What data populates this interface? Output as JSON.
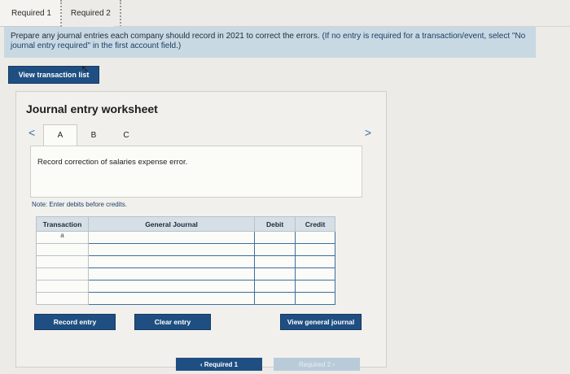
{
  "tabs": [
    {
      "label": "Required 1"
    },
    {
      "label": "Required 2"
    }
  ],
  "instructions": {
    "main": "Prepare any journal entries each company should record in 2021 to correct the errors.",
    "note": "(If no entry is required for a transaction/event, select \"No journal entry required\" in the first account field.)"
  },
  "view_transaction_list_label": "View transaction list",
  "worksheet": {
    "title": "Journal entry worksheet",
    "prev_glyph": "<",
    "next_glyph": ">",
    "sub_tabs": [
      {
        "label": "A",
        "active": true
      },
      {
        "label": "B",
        "active": false
      },
      {
        "label": "C",
        "active": false
      }
    ],
    "description": "Record correction of salaries expense error.",
    "note": "Note: Enter debits before credits.",
    "table": {
      "headers": [
        "Transaction",
        "General Journal",
        "Debit",
        "Credit"
      ],
      "rows": [
        {
          "transaction": "a"
        },
        {
          "transaction": ""
        },
        {
          "transaction": ""
        },
        {
          "transaction": ""
        },
        {
          "transaction": ""
        },
        {
          "transaction": ""
        }
      ]
    },
    "buttons": {
      "record": "Record entry",
      "clear": "Clear entry",
      "view_journal": "View general journal"
    }
  },
  "pager": {
    "prev_label": "Required 1",
    "next_label": "Required 2"
  },
  "colors": {
    "accent": "#1f4f82",
    "instructions_bg": "#c9d9e3",
    "table_header_bg": "#d6dfe5"
  }
}
